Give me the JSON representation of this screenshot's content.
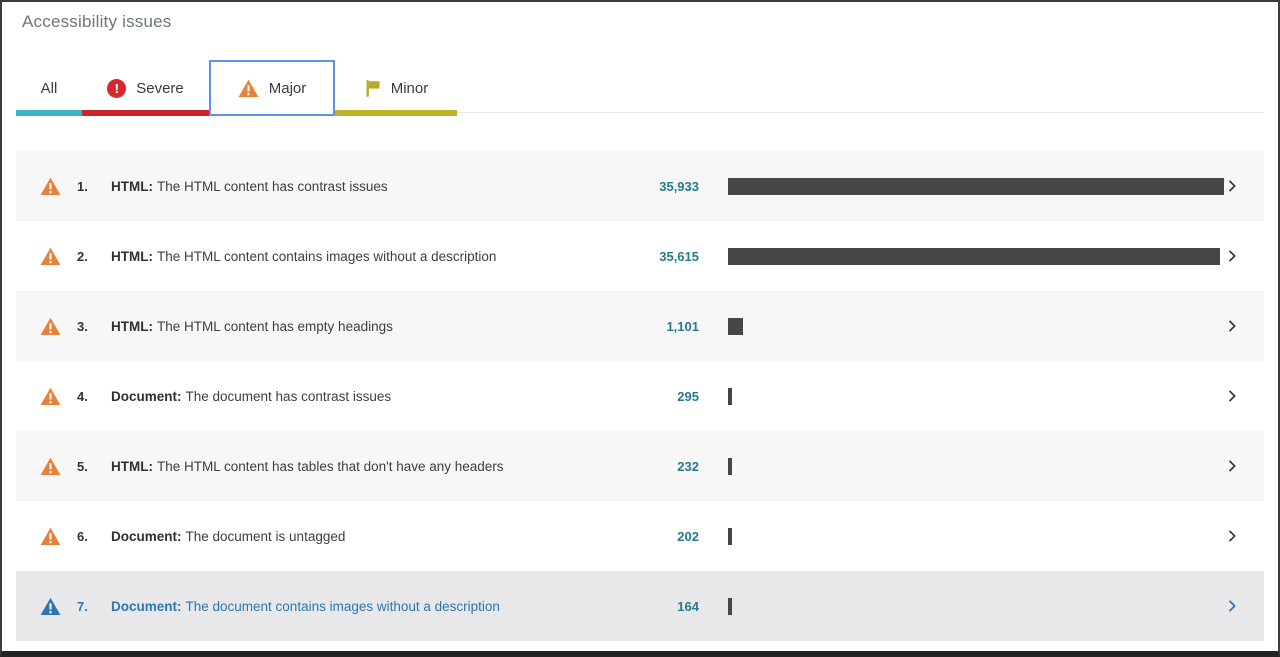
{
  "panel": {
    "title": "Accessibility issues"
  },
  "tabs": {
    "items": [
      {
        "id": "all",
        "label": "All",
        "icon": null,
        "underline_color": "#3cb4c7",
        "active": false
      },
      {
        "id": "severe",
        "label": "Severe",
        "icon": "severe-badge",
        "underline_color": "#cf232b",
        "active": false
      },
      {
        "id": "major",
        "label": "Major",
        "icon": "warning-triangle",
        "underline_color": null,
        "active": true
      },
      {
        "id": "minor",
        "label": "Minor",
        "icon": "flag",
        "underline_color": "#c2b227",
        "active": false
      }
    ]
  },
  "issues": {
    "max_value": 35933,
    "rows": [
      {
        "index": "1.",
        "category": "HTML:",
        "description": "The HTML content has contrast issues",
        "count_display": "35,933",
        "count_value": 35933,
        "highlighted": false
      },
      {
        "index": "2.",
        "category": "HTML:",
        "description": "The HTML content contains images without a description",
        "count_display": "35,615",
        "count_value": 35615,
        "highlighted": false
      },
      {
        "index": "3.",
        "category": "HTML:",
        "description": "The HTML content has empty headings",
        "count_display": "1,101",
        "count_value": 1101,
        "highlighted": false
      },
      {
        "index": "4.",
        "category": "Document:",
        "description": "The document has contrast issues",
        "count_display": "295",
        "count_value": 295,
        "highlighted": false
      },
      {
        "index": "5.",
        "category": "HTML:",
        "description": "The HTML content has tables that don't have any headers",
        "count_display": "232",
        "count_value": 232,
        "highlighted": false
      },
      {
        "index": "6.",
        "category": "Document:",
        "description": "The document is untagged",
        "count_display": "202",
        "count_value": 202,
        "highlighted": false
      },
      {
        "index": "7.",
        "category": "Document:",
        "description": "The document contains images without a description",
        "count_display": "164",
        "count_value": 164,
        "highlighted": true
      }
    ]
  },
  "colors": {
    "accent_teal": "#3cb4c7",
    "accent_red": "#cf232b",
    "accent_olive": "#c2b227",
    "active_tab_border": "#5b93f0",
    "warning_orange": "#e6823c",
    "severe_red": "#d7282f",
    "flag_olive": "#b9ab2a",
    "count_teal": "#27798e",
    "bar_gray": "#464646",
    "row_alt_bg": "#f7f7f8",
    "highlight_bg": "#e8e8ea",
    "highlight_blue": "#2c76b2"
  }
}
